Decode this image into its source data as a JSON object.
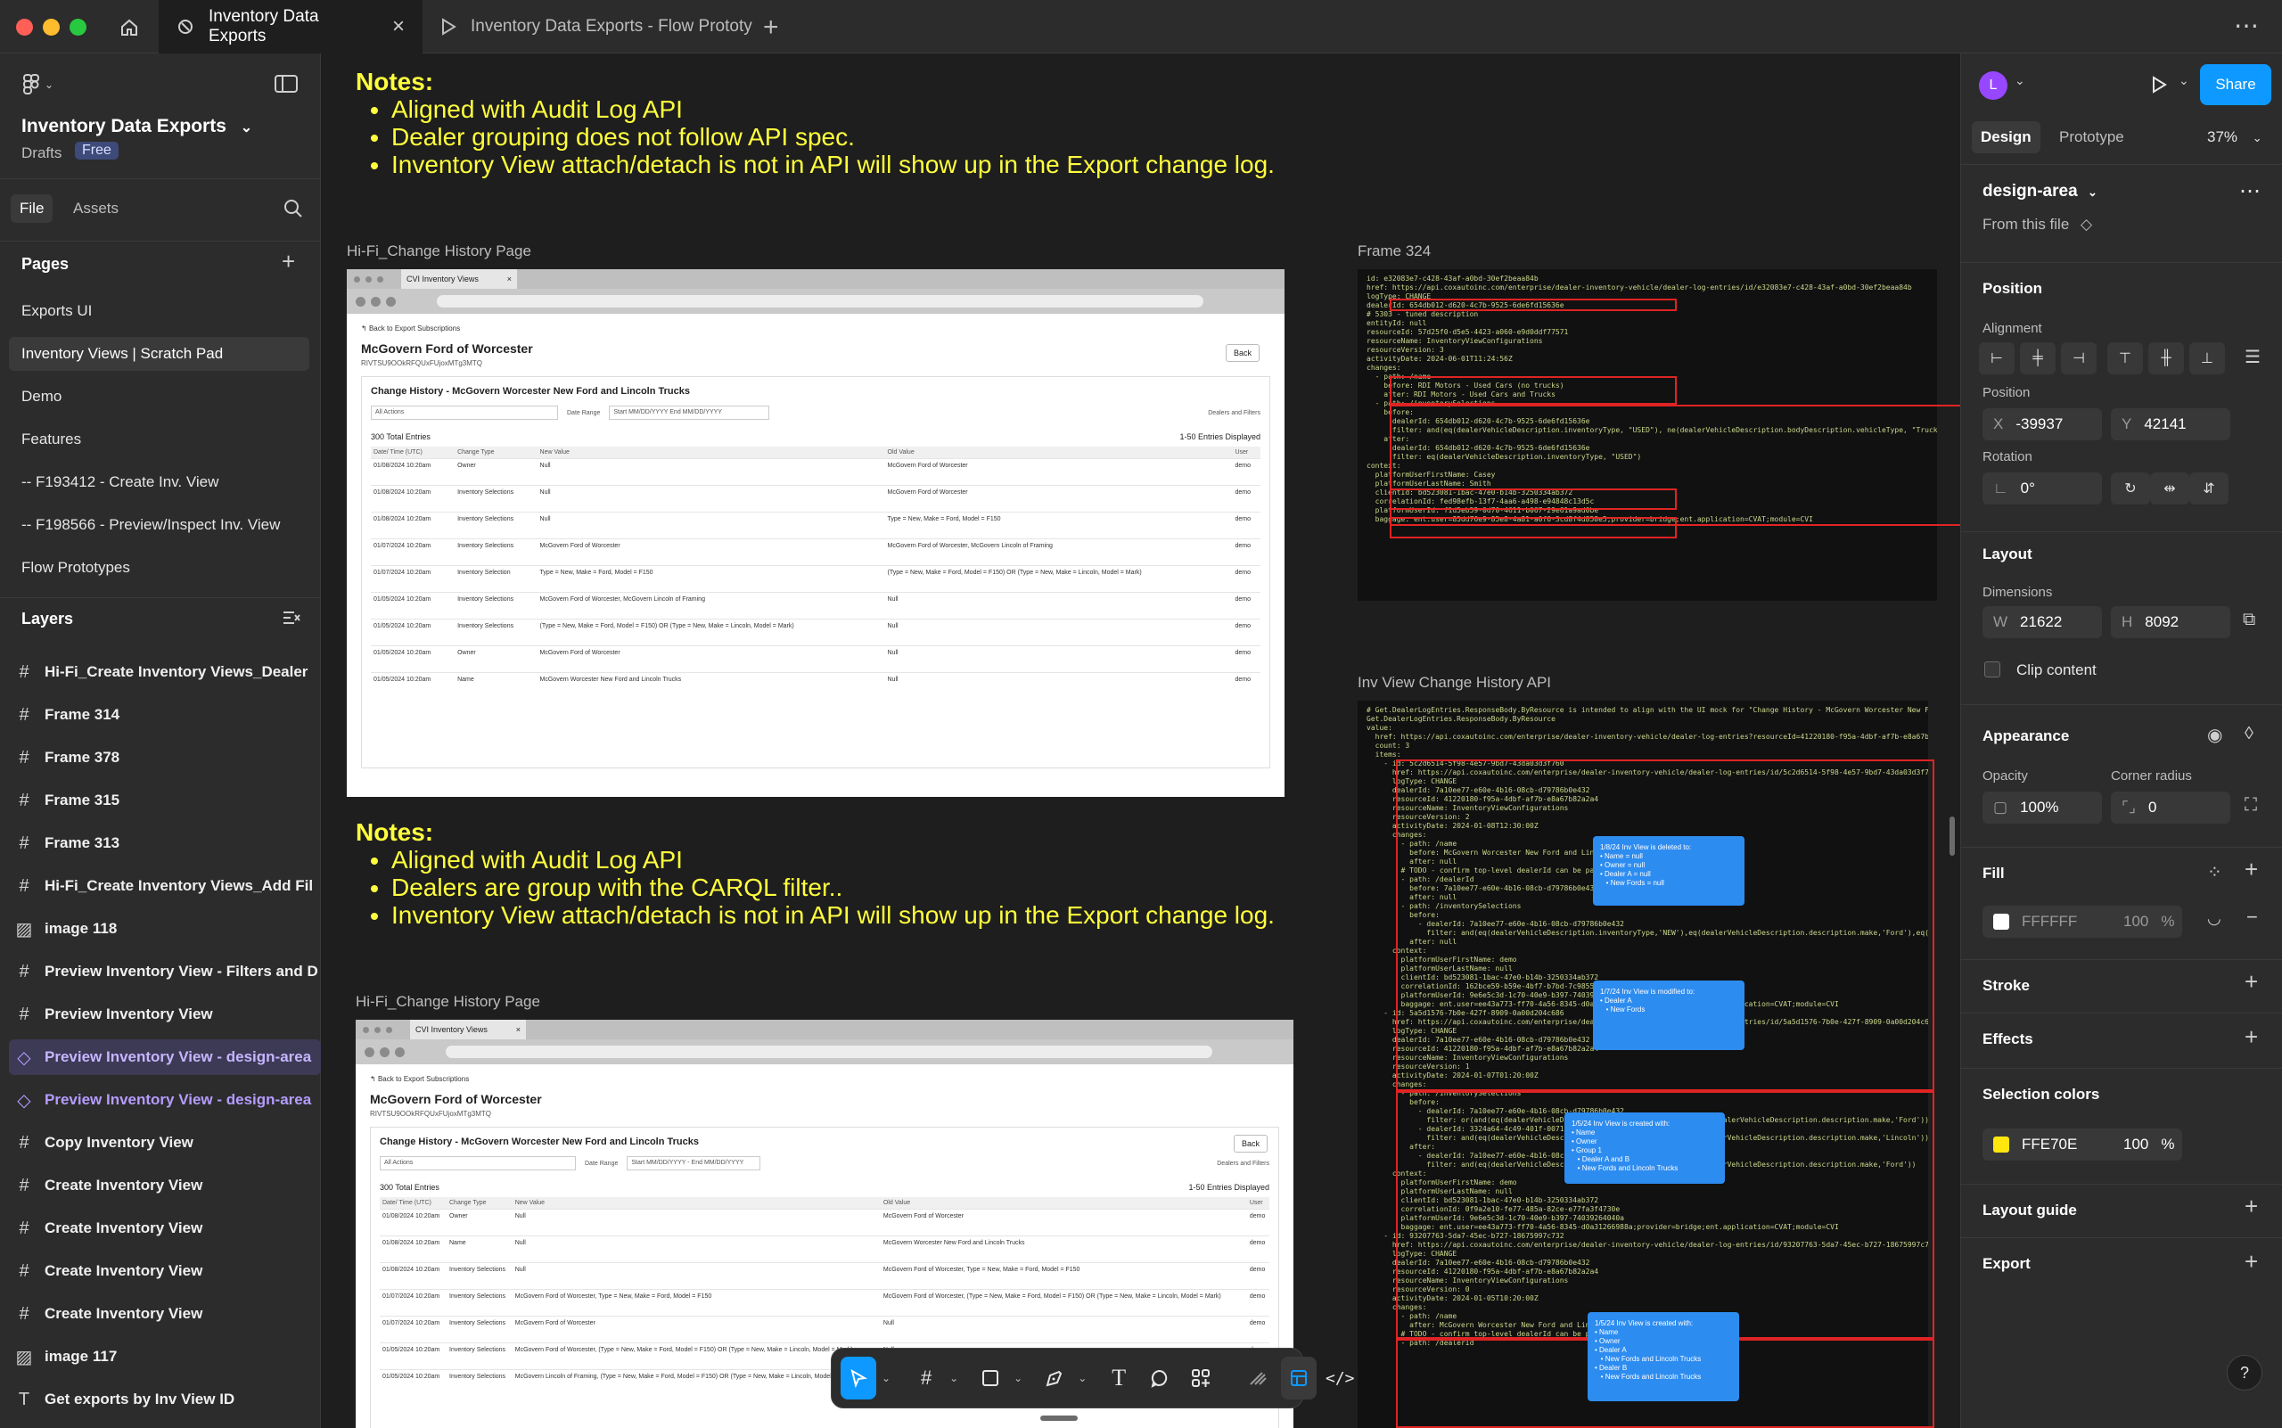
{
  "tabs": {
    "active_label": "Inventory Data Exports",
    "second_label": "Inventory Data Exports - Flow Prototy"
  },
  "left": {
    "project_title": "Inventory Data Exports",
    "drafts": "Drafts",
    "plan_badge": "Free",
    "file_tab": "File",
    "assets_tab": "Assets",
    "pages_header": "Pages",
    "pages": [
      "Exports UI",
      "Inventory Views | Scratch Pad",
      "Demo",
      "Features",
      "-- F193412 - Create Inv. View",
      "-- F198566 - Preview/Inspect Inv. View",
      "Flow Prototypes"
    ],
    "layers_header": "Layers",
    "layers": [
      {
        "label": "Hi-Fi_Create Inventory Views_Dealer",
        "icon": "frame-icon"
      },
      {
        "label": "Frame 314",
        "icon": "frame-icon"
      },
      {
        "label": "Frame 378",
        "icon": "frame-icon"
      },
      {
        "label": "Frame 315",
        "icon": "frame-icon"
      },
      {
        "label": "Frame 313",
        "icon": "frame-icon"
      },
      {
        "label": "Hi-Fi_Create Inventory Views_Add Fil",
        "icon": "frame-icon"
      },
      {
        "label": "image 118",
        "icon": "image-icon"
      },
      {
        "label": "Preview Inventory View - Filters and D",
        "icon": "frame-icon"
      },
      {
        "label": "Preview Inventory View",
        "icon": "frame-icon"
      },
      {
        "label": "Preview Inventory View - design-area",
        "icon": "component-icon"
      },
      {
        "label": "Preview Inventory View - design-area",
        "icon": "component-icon"
      },
      {
        "label": "Copy Inventory View",
        "icon": "frame-icon"
      },
      {
        "label": "Create Inventory View",
        "icon": "frame-icon"
      },
      {
        "label": "Create Inventory View",
        "icon": "frame-icon"
      },
      {
        "label": "Create Inventory View",
        "icon": "frame-icon"
      },
      {
        "label": "Create Inventory View",
        "icon": "frame-icon"
      },
      {
        "label": "image 117",
        "icon": "image-icon"
      },
      {
        "label": "Get exports by Inv View ID",
        "icon": "text-icon"
      }
    ]
  },
  "canvas": {
    "notes1": {
      "title": "Notes:",
      "items": [
        "Aligned with Audit Log API",
        "Dealer grouping does not follow API spec.",
        "Inventory View attach/detach is not in API will show up in the Export change log."
      ]
    },
    "notes2": {
      "title": "Notes:",
      "items": [
        "Aligned with Audit Log API",
        "Dealers are group with the CARQL filter..",
        "Inventory View attach/detach is not in API will show up in the Export change log."
      ]
    },
    "frame_labels": {
      "hifi1": "Hi-Fi_Change History Page",
      "frame324": "Frame 324",
      "invview_api": "Inv View Change History API",
      "hifi2": "Hi-Fi_Change History Page"
    },
    "shot": {
      "browser_tab": "CVI Inventory Views",
      "back_link": "Back to Export Subscriptions",
      "dealer_name": "McGovern Ford of Worcester",
      "dealer_id": "RIVTSU9OOkRFQUxFUjoxMTg3MTQ",
      "back_button": "Back",
      "panel_title": "Change History - McGovern Worcester New Ford and Lincoln Trucks",
      "actions_select": "All Actions",
      "date_range_label": "Date Range",
      "date_start_placeholder": "Start MM/DD/YYYY",
      "date_end_placeholder": "End MM/DD/YYYY",
      "dealers_filters_link": "Dealers and Filters",
      "total_entries": "300 Total Entries",
      "entries_displayed": "1-50   Entries Displayed",
      "columns": [
        "Date/ Time (UTC)",
        "Change Type",
        "New Value",
        "Old Value",
        "User"
      ],
      "rows": [
        [
          "01/08/2024 10:20am",
          "Owner",
          "Null",
          "McGovern Ford of Worcester",
          "demo"
        ],
        [
          "01/08/2024 10:20am",
          "Inventory Selections",
          "Null",
          "McGovern Ford of Worcester",
          "demo"
        ],
        [
          "01/08/2024 10:20am",
          "Inventory Selections",
          "Null",
          "Type = New, Make = Ford, Model = F150",
          "demo"
        ],
        [
          "01/07/2024 10:20am",
          "Inventory Selections",
          "McGovern Ford of Worcester",
          "McGovern Ford of Worcester, McGovern Lincoln of Framing",
          "demo"
        ],
        [
          "01/07/2024 10:20am",
          "Inventory Selection",
          "Type = New, Make = Ford, Model = F150",
          "(Type = New, Make = Ford, Model = F150) OR (Type = New, Make = Lincoln, Model = Mark)",
          "demo"
        ],
        [
          "01/05/2024 10:20am",
          "Inventory Selections",
          "McGovern Ford of Worcester, McGovern Lincoln of Framing",
          "Null",
          "demo"
        ],
        [
          "01/05/2024 10:20am",
          "Inventory Selections",
          "(Type = New, Make = Ford, Model = F150) OR (Type = New, Make = Lincoln, Model = Mark)",
          "Null",
          "demo"
        ],
        [
          "01/05/2024 10:20am",
          "Owner",
          "McGovern Ford of Worcester",
          "Null",
          "demo"
        ],
        [
          "01/05/2024 10:20am",
          "Name",
          "McGovern Worcester New Ford and Lincoln Trucks",
          "Null",
          "demo"
        ]
      ],
      "rows2": [
        [
          "01/08/2024 10:20am",
          "Owner",
          "Null",
          "McGovern Ford of Worcester",
          "demo"
        ],
        [
          "01/08/2024 10:20am",
          "Name",
          "Null",
          "McGovern Worcester New Ford and Lincoln Trucks",
          "demo"
        ],
        [
          "01/08/2024 10:20am",
          "Inventory Selections",
          "Null",
          "McGovern Ford of Worcester, Type = New, Make = Ford, Model = F150",
          "demo"
        ],
        [
          "01/07/2024 10:20am",
          "Inventory Selections",
          "McGovern Ford of Worcester, Type = New, Make = Ford, Model = F150",
          "McGovern Ford of Worcester, (Type = New, Make = Ford, Model = F150) OR (Type = New, Make = Lincoln, Model = Mark)",
          "demo"
        ],
        [
          "01/07/2024 10:20am",
          "Inventory Selections",
          "McGovern Ford of Worcester",
          "Null",
          "demo"
        ],
        [
          "01/05/2024 10:20am",
          "Inventory Selections",
          "McGovern Ford of Worcester, (Type = New, Make = Ford, Model = F150) OR (Type = New, Make = Lincoln, Model = Mark)",
          "Null",
          "demo"
        ],
        [
          "01/05/2024 10:20am",
          "Inventory Selections",
          "McGovern Lincoln of Framing, (Type = New, Make = Ford, Model = F150) OR (Type = New, Make = Lincoln, Model = Mark)",
          "Null",
          "demo"
        ]
      ]
    },
    "code_top": [
      "id: e32083e7-c428-43af-a0bd-30ef2beaa84b",
      "href: https://api.coxautoinc.com/enterprise/dealer-inventory-vehicle/dealer-log-entries/id/e32083e7-c428-43af-a0bd-30ef2beaa84b",
      "logType: CHANGE",
      "dealerId: 654db012-d620-4c7b-9525-6de6fd15636e",
      "# 5303 - tuned description",
      "entityId: null",
      "resourceId: 57d25f0-d5e5-4423-a060-e9d0ddf77571",
      "resourceName: InventoryViewConfigurations",
      "resourceVersion: 3",
      "activityDate: 2024-06-01T11:24:56Z",
      "changes:",
      "  - path: /name",
      "    before: RDI Motors - Used Cars (no trucks)",
      "    after: RDI Motors - Used Cars and Trucks",
      "  - path: /inventorySelections",
      "    before:",
      "      dealerId: 654db012-d620-4c7b-9525-6de6fd15636e",
      "      filter: and(eq(dealerVehicleDescription.inventoryType, \"USED\"), ne(dealerVehicleDescription.bodyDescription.vehicleType, \"Truck\"))",
      "    after:",
      "      dealerId: 654db012-d620-4c7b-9525-6de6fd15636e",
      "      filter: eq(dealerVehicleDescription.inventoryType, \"USED\")",
      "context:",
      "  platformUserFirstName: Casey",
      "  platformUserLastName: Smith",
      "  clientId: bd523081-1bac-47e0-b14b-3250334ab372",
      "  correlationId: fed98efb-13f7-4aa6-a498-e94848c13d5c",
      "  platformUserId: f1d5eb59-0d70-4611-b067-29e61a9ad0be",
      "  baggage: ent.user=85dd76e9-85e8-4a81-a0f6-3cd8f4d858e5;provider=bridge;ent.application=CVAT;module=CVI"
    ],
    "code_bottom": [
      "# Get.DealerLogEntries.ResponseBody.ByResource is intended to align with the UI mock for \"Change History - McGovern Worcester New Ford and Lincoln Trucks\"",
      "Get.DealerLogEntries.ResponseBody.ByResource",
      "value:",
      "  href: https://api.coxautoinc.com/enterprise/dealer-inventory-vehicle/dealer-log-entries?resourceId=41220180-f95a-4dbf-af7b-e8a67b82a2a4&resourceName=InventoryViewConfigurations",
      "  count: 3",
      "  items:",
      "    - id: 5c2d6514-5f98-4e57-9bd7-43da03d3f760",
      "      href: https://api.coxautoinc.com/enterprise/dealer-inventory-vehicle/dealer-log-entries/id/5c2d6514-5f98-4e57-9bd7-43da03d3f760",
      "      logType: CHANGE",
      "      dealerId: 7a10ee77-e60e-4b16-08cb-d79786b0e432",
      "      resourceId: 41220180-f95a-4dbf-af7b-e8a67b82a2a4",
      "      resourceName: InventoryViewConfigurations",
      "      resourceVersion: 2",
      "      activityDate: 2024-01-08T12:30:00Z",
      "      changes:",
      "        - path: /name",
      "          before: McGovern Worcester New Ford and Lincoln Trucks",
      "          after: null",
      "        # TODO - confirm top-level dealerId can be patched or replaced",
      "        - path: /dealerId",
      "          before: 7a10ee77-e60e-4b16-08cb-d79786b0e432",
      "          after: null",
      "        - path: /inventorySelections",
      "          before:",
      "            - dealerId: 7a10ee77-e60e-4b16-08cb-d79786b0e432",
      "              filter: and(eq(dealerVehicleDescription.inventoryType,'NEW'),eq(dealerVehicleDescription.description.make,'Ford'),eq(dealerVehicleDescription.description.model,'F150'))",
      "          after: null",
      "      context:",
      "        platformUserFirstName: demo",
      "        platformUserLastName: null",
      "        clientId: bd523081-1bac-47e0-b14b-3250334ab372",
      "        correlationId: 162bce59-b59e-4bf7-b7bd-7c98551e430a",
      "        platformUserId: 9e6e5c3d-1c70-40e9-b397-74039264040a",
      "        baggage: ent.user=ee43a773-ff70-4a56-8345-d0a31266988a;provider=bridge;ent.application=CVAT;module=CVI",
      "    - id: 5a5d1576-7b0e-427f-8909-0a00d204c686",
      "      href: https://api.coxautoinc.com/enterprise/dealer-inventory-vehicle/dealer-log-entries/id/5a5d1576-7b0e-427f-8909-0a00d204c686",
      "      logType: CHANGE",
      "      dealerId: 7a10ee77-e60e-4b16-08cb-d79786b0e432",
      "      resourceId: 41220180-f95a-4dbf-af7b-e8a67b82a2a4",
      "      resourceName: InventoryViewConfigurations",
      "      resourceVersion: 1",
      "      activityDate: 2024-01-07T01:20:00Z",
      "      changes:",
      "        - path: /inventorySelections",
      "          before:",
      "            - dealerId: 7a10ee77-e60e-4b16-08cb-d79786b0e432",
      "              filter: or(and(eq(dealerVehicleDescription.inventoryType,'NEW'),eq(dealerVehicleDescription.description.make,'Ford')))",
      "            - dealerId: 3324a64-4c49-401f-0071-d5d0302af209",
      "              filter: and(eq(dealerVehicleDescription.inventoryType,'NEW'),eq(dealerVehicleDescription.description.make,'Lincoln'))",
      "          after:",
      "            - dealerId: 7a10ee77-e60e-4b16-08cb-d79786b0e432",
      "              filter: and(eq(dealerVehicleDescription.inventoryType,'NEW'),eq(dealerVehicleDescription.description.make,'Ford'))",
      "      context:",
      "        platformUserFirstName: demo",
      "        platformUserLastName: null",
      "        clientId: bd523081-1bac-47e0-b14b-3250334ab372",
      "        correlationId: 0f9a2e10-fe77-485a-82ce-e77fa3f4730e",
      "        platformUserId: 9e6e5c3d-1c70-40e9-b397-74039264040a",
      "        baggage: ent.user=ee43a773-ff70-4a56-8345-d0a31266988a;provider=bridge;ent.application=CVAT;module=CVI",
      "    - id: 93207763-5da7-45ec-b727-18675997c732",
      "      href: https://api.coxautoinc.com/enterprise/dealer-inventory-vehicle/dealer-log-entries/id/93207763-5da7-45ec-b727-18675997c732",
      "      logType: CHANGE",
      "      dealerId: 7a10ee77-e60e-4b16-08cb-d79786b0e432",
      "      resourceId: 41220180-f95a-4dbf-af7b-e8a67b82a2a4",
      "      resourceName: InventoryViewConfigurations",
      "      resourceVersion: 0",
      "      activityDate: 2024-01-05T10:20:00Z",
      "      changes:",
      "        - path: /name",
      "          after: McGovern Worcester New Ford and Lincoln Trucks",
      "        # TODO - confirm top-level dealerId can be patched or replaced",
      "        - path: /dealerId"
    ],
    "blue_cards": [
      {
        "title": "1/8/24 Inv View is deleted to:",
        "lines": [
          "• Name = null",
          "• Owner = null",
          "• Dealer A = null",
          "   • New Fords = null"
        ]
      },
      {
        "title": "1/7/24 Inv View is modified to:",
        "lines": [
          "• Dealer A",
          "   • New Fords"
        ]
      },
      {
        "title": "1/5/24 Inv View is created with:",
        "lines": [
          "• Name",
          "• Owner",
          "• Group 1",
          "   • Dealer A and B",
          "   • New Fords and Lincoln Trucks"
        ]
      },
      {
        "title": "1/5/24 Inv View is created with:",
        "lines": [
          "• Name",
          "• Owner",
          "• Dealer A",
          "   • New Fords and Lincoln Trucks",
          "• Dealer B",
          "   • New Fords and Lincoln Trucks"
        ]
      }
    ]
  },
  "right": {
    "avatar_letter": "L",
    "share_label": "Share",
    "design_tab": "Design",
    "prototype_tab": "Prototype",
    "zoom": "37%",
    "component_name": "design-area",
    "from_file": "From this file",
    "position_h": "Position",
    "alignment_label": "Alignment",
    "position_label": "Position",
    "x_label": "X",
    "x_value": "-39937",
    "y_label": "Y",
    "y_value": "42141",
    "rotation_label": "Rotation",
    "rotation_value": "0°",
    "layout_h": "Layout",
    "dimensions_label": "Dimensions",
    "w_label": "W",
    "w_value": "21622",
    "h_label": "H",
    "h_value": "8092",
    "clip_content": "Clip content",
    "appearance_h": "Appearance",
    "opacity_label": "Opacity",
    "opacity_value": "100%",
    "corner_label": "Corner radius",
    "corner_value": "0",
    "fill_h": "Fill",
    "fill_hex": "FFFFFF",
    "fill_opacity": "100",
    "fill_pct": "%",
    "stroke_h": "Stroke",
    "effects_h": "Effects",
    "selection_colors_h": "Selection colors",
    "sel_hex": "FFE70E",
    "sel_opacity": "100",
    "sel_pct": "%",
    "layout_guide_h": "Layout guide",
    "export_h": "Export",
    "help": "?"
  },
  "colors": {
    "accent": "#0d99ff",
    "notes_yellow": "#fffe3d",
    "selection_swatch": "#ffe70e",
    "fill_swatch": "#ffffff",
    "component_purple": "#b59cff",
    "avatar": "#9747ff"
  }
}
